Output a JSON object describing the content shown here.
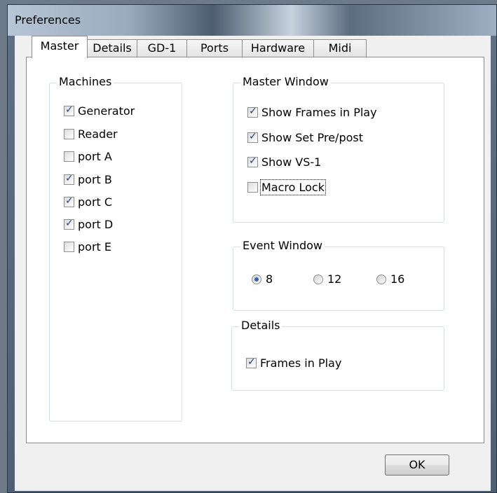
{
  "window": {
    "title": "Preferences"
  },
  "tabs": [
    {
      "label": "Master",
      "active": true
    },
    {
      "label": "Details",
      "active": false
    },
    {
      "label": "GD-1",
      "active": false
    },
    {
      "label": "Ports",
      "active": false
    },
    {
      "label": "Hardware",
      "active": false
    },
    {
      "label": "Midi",
      "active": false
    }
  ],
  "machines": {
    "title": "Machines",
    "items": [
      {
        "label": "Generator",
        "checked": true
      },
      {
        "label": "Reader",
        "checked": false
      },
      {
        "label": "port A",
        "checked": false
      },
      {
        "label": "port B",
        "checked": true
      },
      {
        "label": "port C",
        "checked": true
      },
      {
        "label": "port D",
        "checked": true
      },
      {
        "label": "port E",
        "checked": false
      }
    ]
  },
  "master_window": {
    "title": "Master Window",
    "items": [
      {
        "label": "Show Frames in Play",
        "checked": true
      },
      {
        "label": "Show Set Pre/post",
        "checked": true
      },
      {
        "label": "Show VS-1",
        "checked": true
      },
      {
        "label": "Macro Lock",
        "checked": false
      }
    ]
  },
  "event_window": {
    "title": "Event Window",
    "options": [
      {
        "label": "8",
        "selected": true
      },
      {
        "label": "12",
        "selected": false
      },
      {
        "label": "16",
        "selected": false
      }
    ]
  },
  "details": {
    "title": "Details",
    "items": [
      {
        "label": "Frames in Play",
        "checked": true
      }
    ]
  },
  "buttons": {
    "ok": "OK"
  }
}
